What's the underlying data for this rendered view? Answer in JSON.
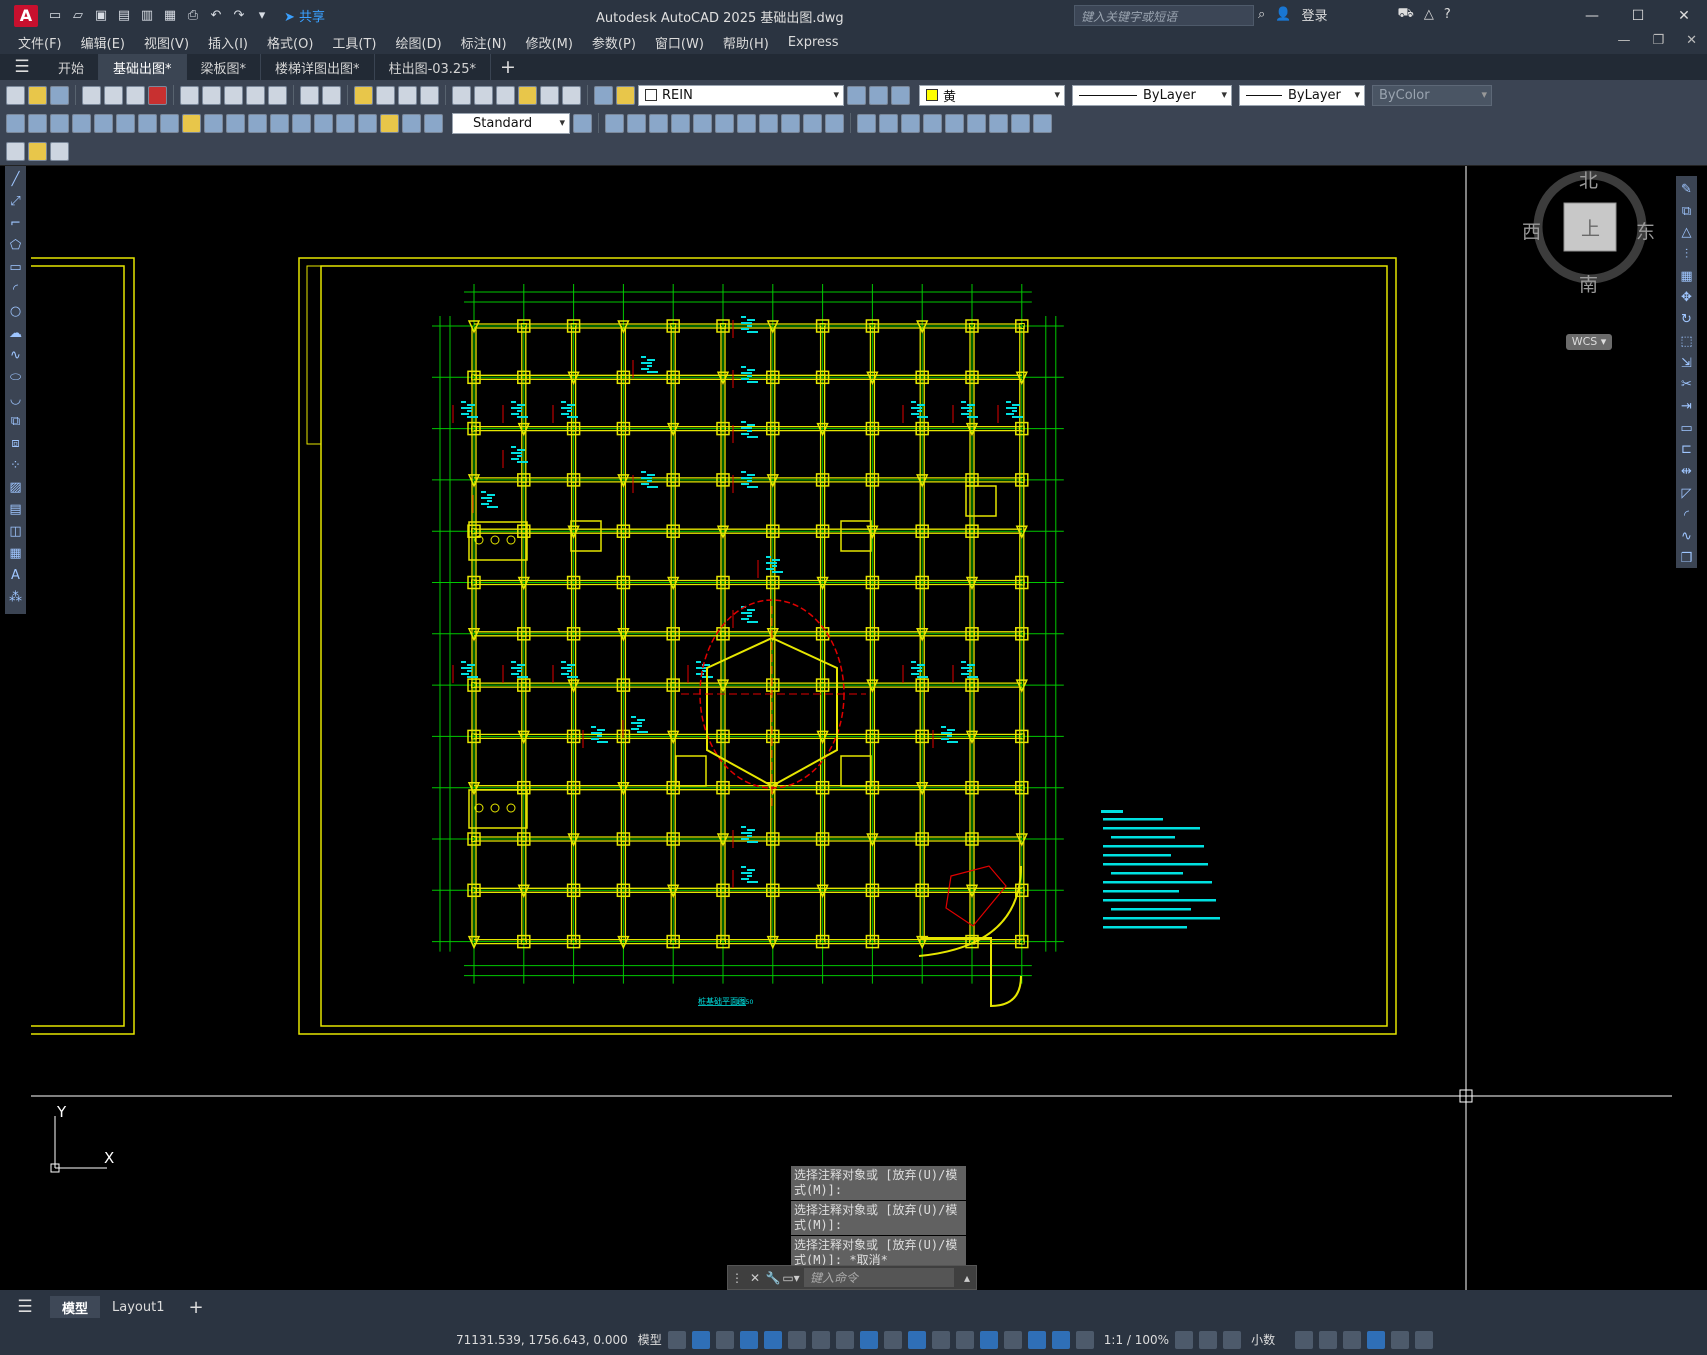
{
  "app": {
    "logo_letter": "A",
    "title": "Autodesk AutoCAD 2025    基础出图.dwg",
    "share_label": "共享",
    "search_placeholder": "键入关键字或短语",
    "login_label": "登录"
  },
  "menu": [
    "文件(F)",
    "编辑(E)",
    "视图(V)",
    "插入(I)",
    "格式(O)",
    "工具(T)",
    "绘图(D)",
    "标注(N)",
    "修改(M)",
    "参数(P)",
    "窗口(W)",
    "帮助(H)",
    "Express"
  ],
  "tabs": [
    {
      "label": "开始",
      "active": false
    },
    {
      "label": "基础出图*",
      "active": true
    },
    {
      "label": "梁板图*",
      "active": false
    },
    {
      "label": "楼梯详图出图*",
      "active": false
    },
    {
      "label": "柱出图-03.25*",
      "active": false
    }
  ],
  "toolbar": {
    "layer_name": "REIN",
    "color_name": "黄",
    "linetype": "ByLayer",
    "lineweight": "ByLayer",
    "plotstyle": "ByColor",
    "text_style": "Standard"
  },
  "viewcube": {
    "north": "北",
    "south": "南",
    "east": "东",
    "west": "西",
    "top": "上",
    "wcs": "WCS"
  },
  "drawing": {
    "plan_title": "桩基础平面图",
    "plan_scale": "1:150"
  },
  "command": {
    "history": [
      "选择注释对象或 [放弃(U)/模式(M)]:",
      "选择注释对象或 [放弃(U)/模式(M)]:",
      "选择注释对象或 [放弃(U)/模式(M)]: *取消*"
    ],
    "input_placeholder": "键入命令"
  },
  "layout_tabs": [
    {
      "label": "模型",
      "active": true
    },
    {
      "label": "Layout1",
      "active": false
    }
  ],
  "status": {
    "coordinates": "71131.539, 1756.643, 0.000",
    "mode": "模型",
    "annotation_scale": "1:1 / 100%",
    "units": "小数"
  },
  "colors": {
    "title_bg": "#2b3441",
    "toolbar_bg": "#3b4453",
    "cad_yellow": "#e6e600",
    "cad_green": "#00c800",
    "cad_cyan": "#00e0e0",
    "cad_red": "#e00000"
  }
}
